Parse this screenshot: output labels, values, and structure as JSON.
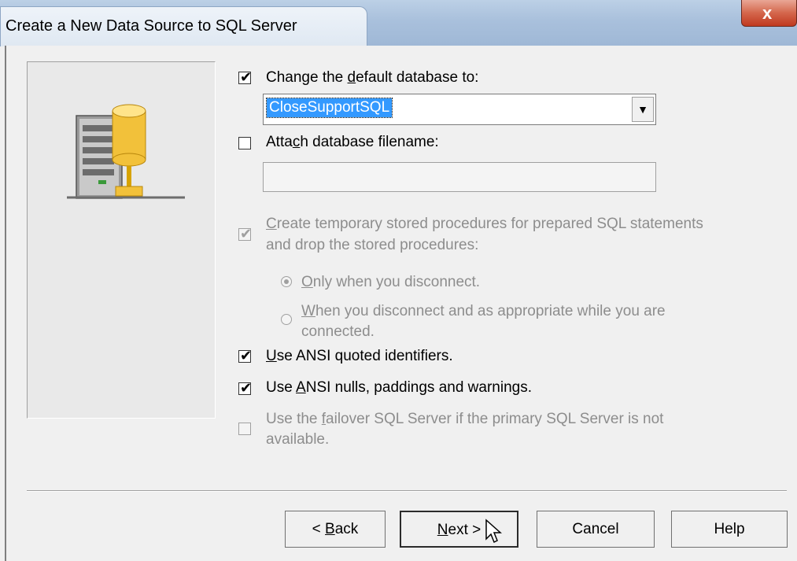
{
  "window": {
    "title": "Create a New Data Source to SQL Server",
    "close_label": "x"
  },
  "options": {
    "change_default_db": {
      "checked": true,
      "pre": "Change the ",
      "u": "d",
      "post": "efault database to:"
    },
    "database_value": "CloseSupportSQL",
    "attach_db": {
      "checked": false,
      "pre": "Atta",
      "u": "c",
      "post": "h database filename:",
      "value": ""
    },
    "temp_procs": {
      "checked": true,
      "enabled": false,
      "u": "C",
      "line1": "reate temporary stored procedures for prepared SQL statements",
      "line2": "and drop the stored procedures:"
    },
    "radio_disconnect": {
      "selected": true,
      "u": "O",
      "post": "nly when you disconnect."
    },
    "radio_appropriate": {
      "selected": false,
      "u": "W",
      "line1": "hen you disconnect and as appropriate while you are",
      "line2": "connected."
    },
    "ansi_quoted": {
      "checked": true,
      "u": "U",
      "post": "se ANSI quoted identifiers."
    },
    "ansi_nulls": {
      "checked": true,
      "pre": "Use ",
      "u": "A",
      "post": "NSI nulls, paddings and warnings."
    },
    "failover": {
      "checked": false,
      "enabled": false,
      "pre": "Use the ",
      "u": "f",
      "line1": "ailover SQL Server if the primary SQL Server is not",
      "line2": "available."
    }
  },
  "buttons": {
    "back": {
      "pre": "< ",
      "u": "B",
      "post": "ack"
    },
    "next": {
      "u": "N",
      "post": "ext >"
    },
    "cancel": "Cancel",
    "help": "Help"
  }
}
